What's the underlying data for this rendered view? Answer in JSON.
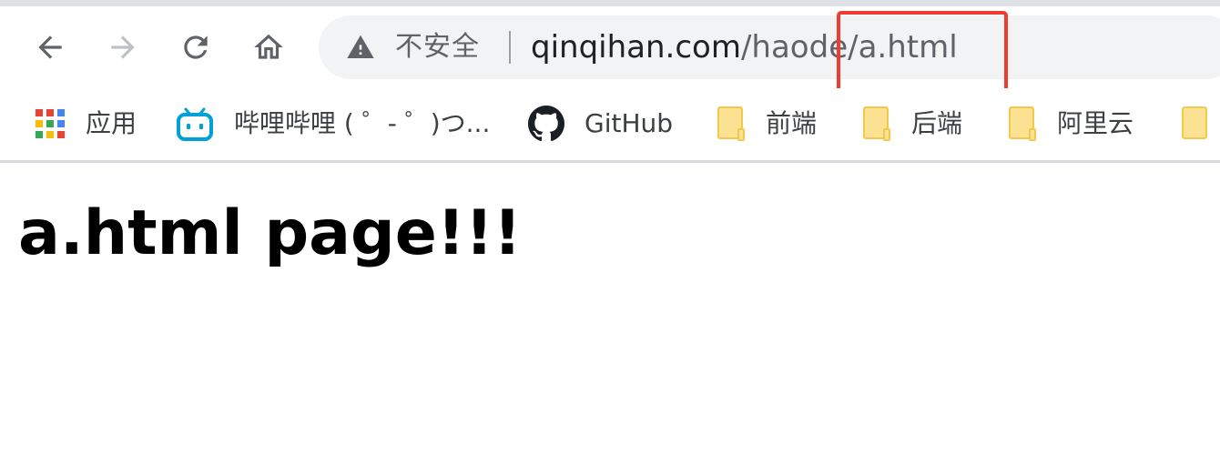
{
  "toolbar": {
    "security_label": "不安全",
    "url_host": "qinqihan.com",
    "url_path": "/haode/a.html"
  },
  "bookmarks": [
    {
      "label": "应用",
      "icon": "apps-grid-icon"
    },
    {
      "label": "哔哩哔哩 ( ゜- ゜)つ...",
      "icon": "bilibili-icon"
    },
    {
      "label": "GitHub",
      "icon": "github-icon"
    },
    {
      "label": "前端",
      "icon": "folder-icon"
    },
    {
      "label": "后端",
      "icon": "folder-icon"
    },
    {
      "label": "阿里云",
      "icon": "folder-icon"
    }
  ],
  "page": {
    "heading": "a.html page!!!"
  },
  "colors": {
    "highlight": "#f23b30",
    "folder_fill": "#fde293",
    "folder_stroke": "#f2c94c",
    "bilibili": "#00a1d6",
    "omnibox_bg": "#f1f3f4"
  }
}
